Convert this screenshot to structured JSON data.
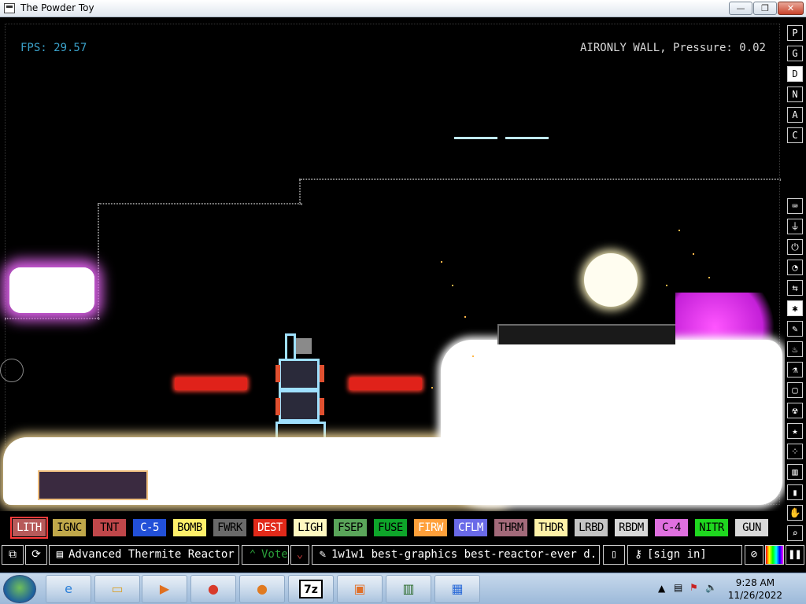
{
  "window": {
    "title": "The Powder Toy",
    "minimize_glyph": "—",
    "maximize_glyph": "❐",
    "close_glyph": "✕"
  },
  "hud": {
    "fps": "FPS: 29.57",
    "status": "AIRONLY WALL, Pressure: 0.02"
  },
  "right_toolbar": {
    "top": [
      "P",
      "G",
      "D",
      "N",
      "A",
      "C"
    ],
    "active_top": "D",
    "tools": [
      "keyboard-icon",
      "plug-icon",
      "power-icon",
      "gauge-icon",
      "arrows-icon",
      "spray-icon",
      "pencil-icon",
      "flame-icon",
      "flask-icon",
      "square-icon",
      "radiation-icon",
      "star-icon",
      "dots-icon",
      "tube-icon",
      "bookmark-icon",
      "hand-icon",
      "search-icon"
    ]
  },
  "palette": {
    "selected": "LITH",
    "elements": [
      {
        "label": "LITH",
        "bg": "#b75a5a",
        "fg": "#ffffff"
      },
      {
        "label": "IGNC",
        "bg": "#c0a84a",
        "fg": "#000000"
      },
      {
        "label": "TNT",
        "bg": "#c0474a",
        "fg": "#000000"
      },
      {
        "label": "C-5",
        "bg": "#2250d8",
        "fg": "#ffffff"
      },
      {
        "label": "BOMB",
        "bg": "#fff06a",
        "fg": "#000000"
      },
      {
        "label": "FWRK",
        "bg": "#6a6a6a",
        "fg": "#000000"
      },
      {
        "label": "DEST",
        "bg": "#e22a1a",
        "fg": "#ffffff"
      },
      {
        "label": "LIGH",
        "bg": "#fff8c0",
        "fg": "#000000"
      },
      {
        "label": "FSEP",
        "bg": "#5aa55a",
        "fg": "#000000"
      },
      {
        "label": "FUSE",
        "bg": "#0ea52a",
        "fg": "#000000"
      },
      {
        "label": "FIRW",
        "bg": "#ffa03a",
        "fg": "#ffffff"
      },
      {
        "label": "CFLM",
        "bg": "#6a6ae8",
        "fg": "#ffffff"
      },
      {
        "label": "THRM",
        "bg": "#a36a7a",
        "fg": "#000000"
      },
      {
        "label": "THDR",
        "bg": "#fff2a8",
        "fg": "#000000"
      },
      {
        "label": "LRBD",
        "bg": "#c4c4c4",
        "fg": "#000000"
      },
      {
        "label": "RBDM",
        "bg": "#d8d8d8",
        "fg": "#000000"
      },
      {
        "label": "C-4",
        "bg": "#e070e0",
        "fg": "#000000"
      },
      {
        "label": "NITR",
        "bg": "#1fd81f",
        "fg": "#000000"
      },
      {
        "label": "GUN",
        "bg": "#dadada",
        "fg": "#000000"
      }
    ]
  },
  "bottom_bar": {
    "save_title": "Advanced Thermite Reactor",
    "vote_label": "Vote",
    "tags": "1w1w1 best-graphics best-reactor-ever d...",
    "sign_in": "[sign in]"
  },
  "taskbar": {
    "apps": [
      "ie-icon",
      "explorer-icon",
      "media-player-icon",
      "chrome-icon",
      "firefox-icon",
      "7zip-icon",
      "powder-toy-icon",
      "pc-icon",
      "control-panel-icon"
    ],
    "zip_label": "7z",
    "time": "9:28 AM",
    "date": "11/26/2022"
  }
}
